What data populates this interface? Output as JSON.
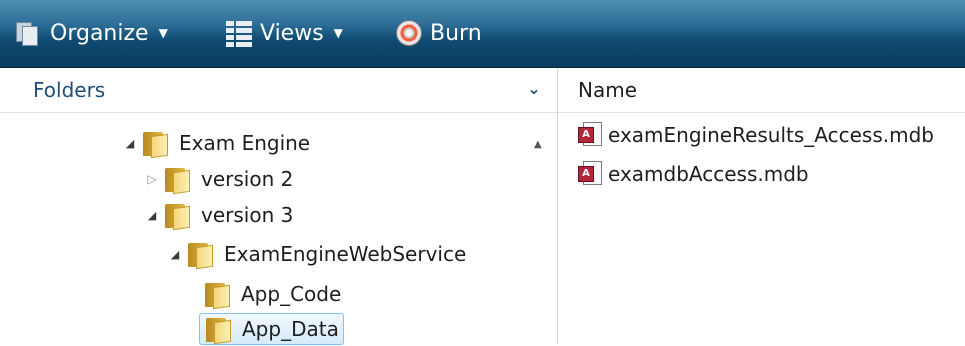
{
  "toolbar": {
    "organize_label": "Organize",
    "views_label": "Views",
    "burn_label": "Burn"
  },
  "folders_pane": {
    "header_label": "Folders",
    "tree": [
      {
        "label": "Exam Engine",
        "expander": "expanded"
      },
      {
        "label": "version 2",
        "expander": "collapsed"
      },
      {
        "label": "version 3",
        "expander": "expanded"
      },
      {
        "label": "ExamEngineWebService",
        "expander": "expanded"
      },
      {
        "label": "App_Code",
        "expander": "none"
      },
      {
        "label": "App_Data",
        "expander": "none",
        "selected": true
      }
    ]
  },
  "files_pane": {
    "column_name": "Name",
    "files": [
      {
        "name": "examEngineResults_Access.mdb"
      },
      {
        "name": "examdbAccess.mdb"
      }
    ]
  },
  "colors": {
    "toolbar_top": "#4f8fb3",
    "toolbar_bottom": "#0a3b5c",
    "header_text": "#1f4e79",
    "selection_border": "#84c2ee"
  }
}
